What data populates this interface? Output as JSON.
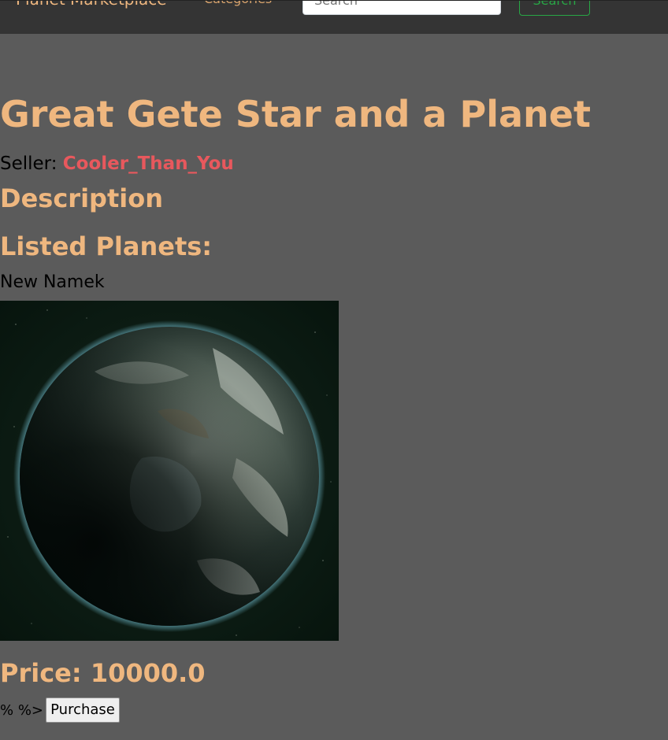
{
  "navbar": {
    "brand": "Planet Marketplace",
    "categories_label": "Categories",
    "search_placeholder": "Search",
    "search_button": "Search"
  },
  "listing": {
    "title": "Great Gete Star and a Planet",
    "seller_label": "Seller:",
    "seller_name": "Cooler_Than_You",
    "description_heading": "Description",
    "planets_heading": "Listed Planets:",
    "planets": [
      {
        "name": "New Namek",
        "image": "planet-photo"
      }
    ],
    "price": "Price: 10000.0",
    "stray_template_text": "% %>",
    "purchase_label": "Purchase"
  },
  "colors": {
    "background": "#5b5b5b",
    "navbar": "#343434",
    "heading": "#efb77f",
    "seller_link": "#e8585d",
    "success": "#28a745"
  }
}
